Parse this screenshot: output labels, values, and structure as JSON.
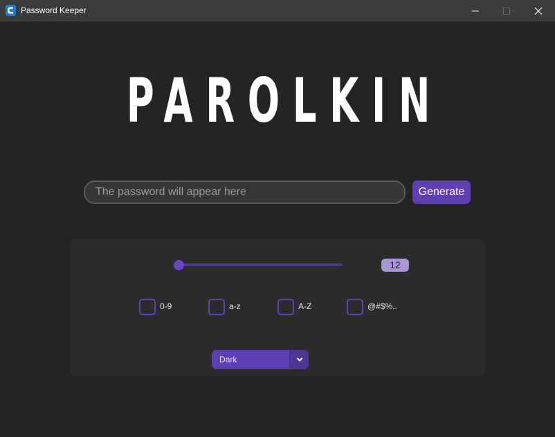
{
  "window": {
    "title": "Password Keeper",
    "icon": "app-c-icon",
    "controls": [
      "minimize-icon",
      "maximize-icon",
      "close-icon"
    ]
  },
  "logo": {
    "text": "PAROLKIN"
  },
  "password": {
    "value": "",
    "placeholder": "The password will appear here"
  },
  "generate": {
    "label": "Generate"
  },
  "length": {
    "value": "12",
    "slider_fraction": 0.0
  },
  "options": [
    {
      "label": "0-9",
      "checked": false
    },
    {
      "label": "a-z",
      "checked": false
    },
    {
      "label": "A-Z",
      "checked": false
    },
    {
      "label": "@#$%..",
      "checked": false
    }
  ],
  "theme": {
    "selected": "Dark"
  },
  "colors": {
    "accent": "#5f3fb3",
    "accent_dark": "#4e3596",
    "background": "#242424",
    "panel": "#2b2b2b",
    "badge": "#a797d4"
  }
}
